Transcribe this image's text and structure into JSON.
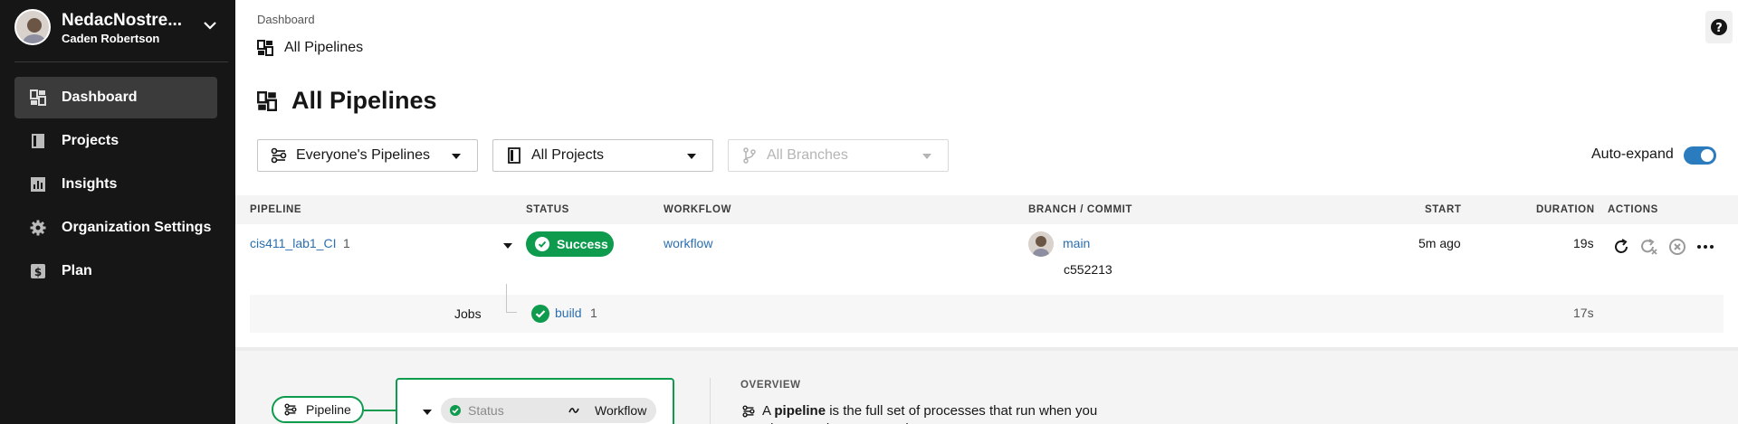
{
  "sidebar": {
    "org_name": "NedacNostre...",
    "user_name": "Caden Robertson",
    "items": [
      {
        "label": "Dashboard",
        "icon": "dashboard-icon",
        "active": true
      },
      {
        "label": "Projects",
        "icon": "book-icon"
      },
      {
        "label": "Insights",
        "icon": "chart-icon"
      },
      {
        "label": "Organization Settings",
        "icon": "gear-icon"
      },
      {
        "label": "Plan",
        "icon": "dollar-icon"
      }
    ]
  },
  "header": {
    "breadcrumb": "Dashboard",
    "sub_breadcrumb": "All Pipelines",
    "title": "All Pipelines",
    "help": "?"
  },
  "filters": {
    "pipelines": "Everyone's Pipelines",
    "projects": "All Projects",
    "branches": "All Branches",
    "auto_expand_label": "Auto-expand",
    "auto_expand_on": true
  },
  "table": {
    "headers": [
      "PIPELINE",
      "STATUS",
      "WORKFLOW",
      "BRANCH / COMMIT",
      "START",
      "DURATION",
      "ACTIONS"
    ],
    "row": {
      "pipeline": "cis411_lab1_CI",
      "number": "1",
      "status": "Success",
      "workflow": "workflow",
      "branch": "main",
      "commit": "c552213",
      "start": "5m ago",
      "duration": "19s"
    },
    "jobs": {
      "label": "Jobs",
      "name": "build",
      "number": "1",
      "duration": "17s"
    }
  },
  "overview": {
    "pipeline_pill": "Pipeline",
    "status_label": "Status",
    "workflow_label": "Workflow",
    "title": "OVERVIEW",
    "text_prefix": "A ",
    "text_bold": "pipeline",
    "text_suffix": " is the full set of processes that run when you trigger work on your projects."
  },
  "colors": {
    "sidebar_bg": "#161616",
    "success": "#0e9b4e",
    "link": "#2b6fb0",
    "toggle": "#2b7bbf"
  }
}
